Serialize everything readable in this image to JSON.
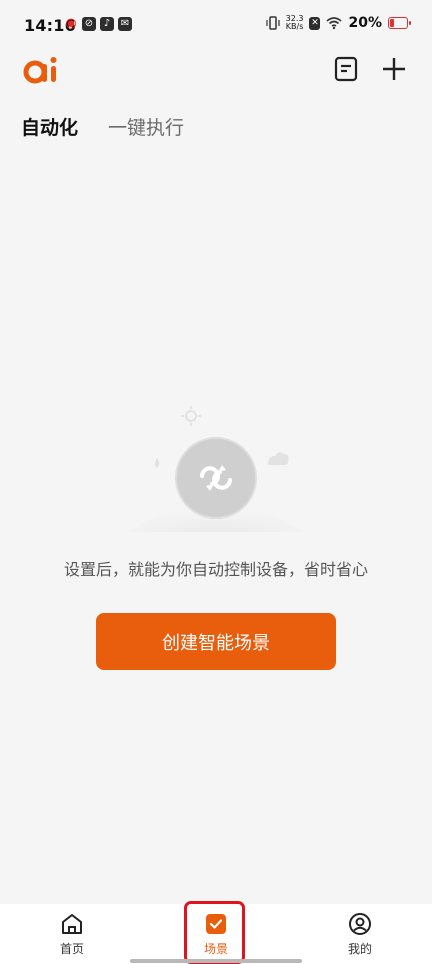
{
  "status_bar": {
    "time": "14:16",
    "net_speed_value": "32.3",
    "net_speed_unit": "KB/s",
    "battery_percent": "20%"
  },
  "header": {
    "logo_text": "ai",
    "notes_icon": "document-icon",
    "add_icon": "plus-icon"
  },
  "tabs": [
    {
      "label": "自动化",
      "active": true
    },
    {
      "label": "一键执行",
      "active": false
    }
  ],
  "empty_state": {
    "message": "设置后，就能为你自动控制设备，省时省心",
    "button_label": "创建智能场景"
  },
  "bottom_nav": [
    {
      "label": "首页",
      "icon": "home-icon"
    },
    {
      "label": "场景",
      "icon": "scene-check-icon",
      "selected": true
    },
    {
      "label": "我的",
      "icon": "profile-icon"
    }
  ],
  "colors": {
    "accent": "#e85e0c",
    "highlight": "#e0141e",
    "background": "#f5f5f5"
  }
}
